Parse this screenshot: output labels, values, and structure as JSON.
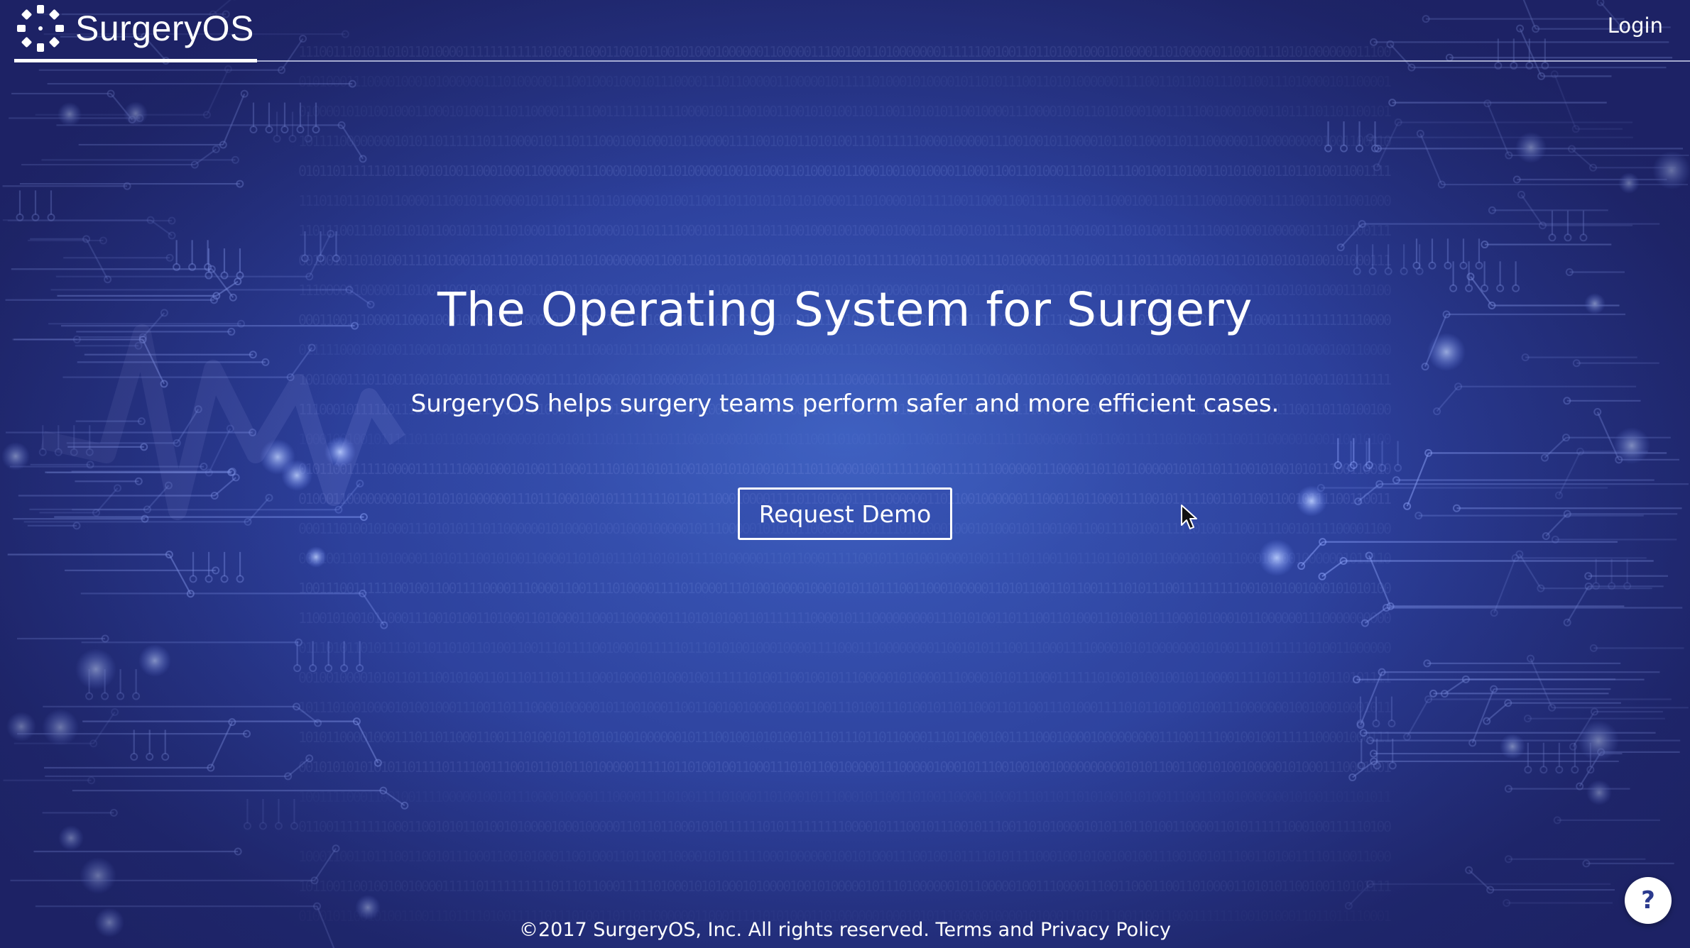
{
  "brand": {
    "name": "SurgeryOS",
    "logo_icon": "dotted-ring-logo-icon"
  },
  "nav": {
    "login_label": "Login"
  },
  "hero": {
    "title": "The Operating System for Surgery",
    "subtitle": "SurgeryOS helps surgery teams perform safer and more efficient cases.",
    "cta_label": "Request Demo"
  },
  "footer": {
    "copyright": "©2017 SurgeryOS, Inc. All rights reserved.",
    "terms_label": "Terms and Privacy Policy"
  },
  "help": {
    "label": "?",
    "icon": "help-question-icon"
  },
  "theme": {
    "background_primary": "#3150ac",
    "background_dark": "#24307e",
    "text_color": "#ffffff",
    "circuit_color": "#8fa6ff"
  }
}
